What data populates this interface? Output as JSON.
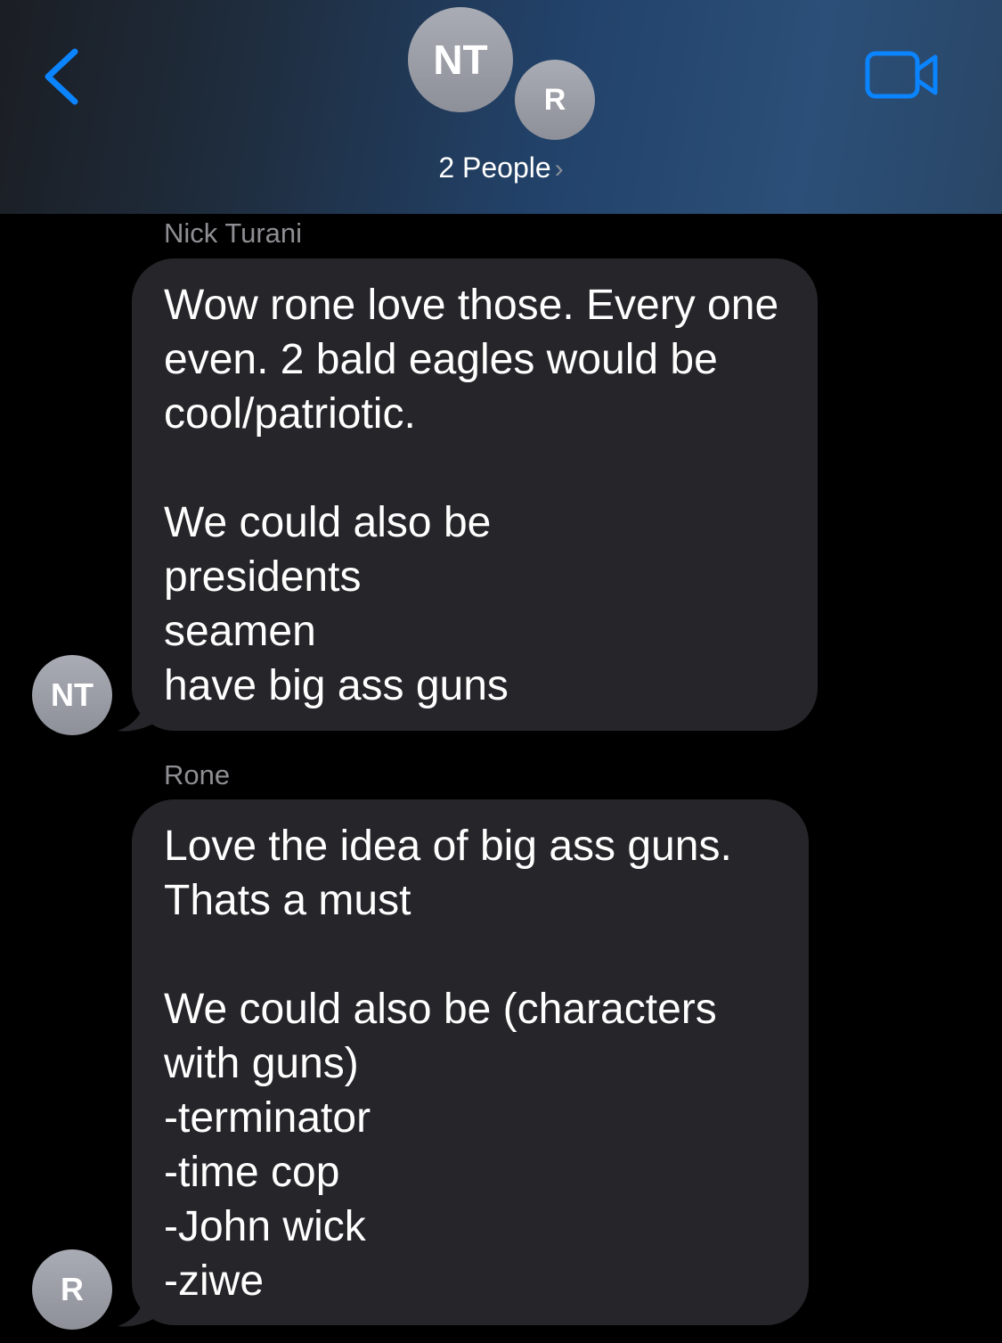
{
  "header": {
    "avatars": [
      {
        "initials": "NT"
      },
      {
        "initials": "R"
      }
    ],
    "people_label": "2 People",
    "people_chevron": "›",
    "accent_color": "#0a84ff"
  },
  "messages": [
    {
      "sender": "Nick Turani",
      "avatar_initials": "NT",
      "text": "Wow rone love those. Every one even. 2 bald eagles would be cool/patriotic.\n\nWe could also be\npresidents\nseamen\nhave big ass guns"
    },
    {
      "sender": "Rone",
      "avatar_initials": "R",
      "text": "Love the idea of big ass guns. Thats a must\n\nWe could also be (characters with guns)\n-terminator\n-time cop\n-John wick\n-ziwe"
    }
  ],
  "icons": {
    "back": "chevron-left-icon",
    "video": "video-camera-icon"
  },
  "colors": {
    "bubble": "#26252a",
    "background": "#000000",
    "sender_label": "#8e8e93"
  }
}
